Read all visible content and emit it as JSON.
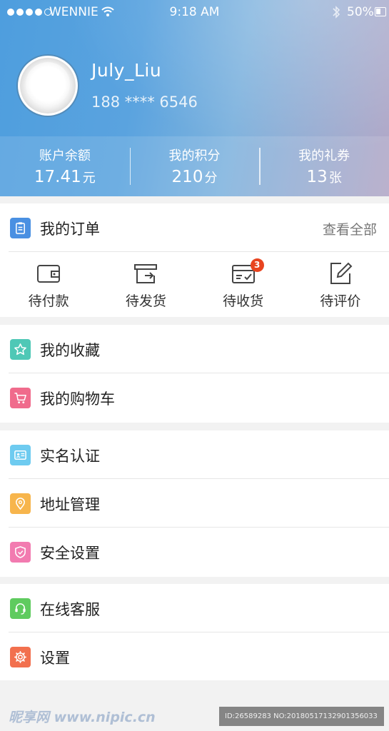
{
  "status_bar": {
    "carrier": "WENNIE",
    "time": "9:18 AM",
    "battery": "50%"
  },
  "profile": {
    "name": "July_Liu",
    "phone": "188 **** 6546"
  },
  "stats": [
    {
      "label": "账户余额",
      "value": "17.41",
      "unit": "元"
    },
    {
      "label": "我的积分",
      "value": "210",
      "unit": "分"
    },
    {
      "label": "我的礼券",
      "value": "13",
      "unit": "张"
    }
  ],
  "orders": {
    "title": "我的订单",
    "view_all": "查看全部",
    "items": [
      {
        "label": "待付款",
        "icon": "wallet-icon"
      },
      {
        "label": "待发货",
        "icon": "package-icon"
      },
      {
        "label": "待收货",
        "icon": "receive-box-icon",
        "badge": "3"
      },
      {
        "label": "待评价",
        "icon": "edit-icon"
      }
    ]
  },
  "menu": {
    "favorites": "我的收藏",
    "cart": "我的购物车",
    "verify": "实名认证",
    "address": "地址管理",
    "security": "安全设置",
    "service": "在线客服",
    "settings": "设置"
  },
  "colors": {
    "orders_icon": "#4a90e2",
    "favorites_icon": "#4fc8b6",
    "cart_icon": "#f06b8c",
    "verify_icon": "#6ecbf0",
    "address_icon": "#f7b54c",
    "security_icon": "#f27bb0",
    "service_icon": "#5fcb5f",
    "settings_icon": "#f2704e",
    "badge": "#e8441f"
  },
  "watermark": {
    "logo": "昵享网 www.nipic.cn",
    "id": "ID:26589283 NO:20180517132901356033"
  }
}
